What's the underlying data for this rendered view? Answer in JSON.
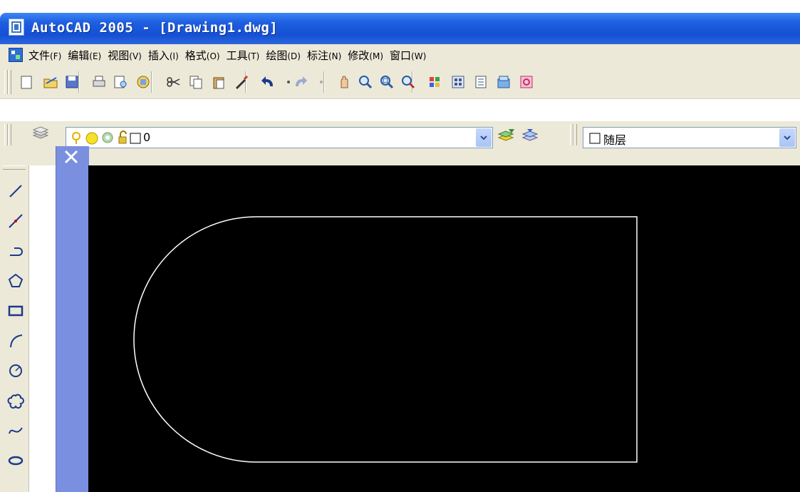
{
  "window": {
    "title": "AutoCAD 2005 - [Drawing1.dwg]"
  },
  "menu": {
    "items": [
      {
        "label": "文件",
        "accel": "(F)"
      },
      {
        "label": "编辑",
        "accel": "(E)"
      },
      {
        "label": "视图",
        "accel": "(V)"
      },
      {
        "label": "插入",
        "accel": "(I)"
      },
      {
        "label": "格式",
        "accel": "(O)"
      },
      {
        "label": "工具",
        "accel": "(T)"
      },
      {
        "label": "绘图",
        "accel": "(D)"
      },
      {
        "label": "标注",
        "accel": "(N)"
      },
      {
        "label": "修改",
        "accel": "(M)"
      },
      {
        "label": "窗口",
        "accel": "(W)"
      }
    ]
  },
  "standard_toolbar": {
    "icons": [
      "new-icon",
      "open-icon",
      "save-icon",
      "print-icon",
      "print-preview-icon",
      "publish-icon",
      "cut-icon",
      "copy-icon",
      "paste-icon",
      "match-properties-icon",
      "undo-icon",
      "undo-dropdown-icon",
      "redo-icon",
      "redo-dropdown-icon",
      "pan-icon",
      "zoom-realtime-icon",
      "zoom-window-icon",
      "zoom-previous-icon",
      "properties-icon",
      "design-center-icon",
      "tool-palettes-icon",
      "sheet-set-icon",
      "markup-icon"
    ]
  },
  "layers_toolbar": {
    "layer_value": "0",
    "color_value": "随层"
  },
  "draw_toolbar": {
    "icons": [
      "line-icon",
      "construction-line-icon",
      "polyline-icon",
      "polygon-icon",
      "rectangle-icon",
      "arc-icon",
      "circle-icon",
      "revision-cloud-icon",
      "spline-icon",
      "ellipse-icon"
    ]
  },
  "colors": {
    "titlebar": "#1f5fe0",
    "chrome": "#ece9d8",
    "canvas": "#000000",
    "float_strip": "#7b8fe0",
    "entity": "#ffffff"
  }
}
